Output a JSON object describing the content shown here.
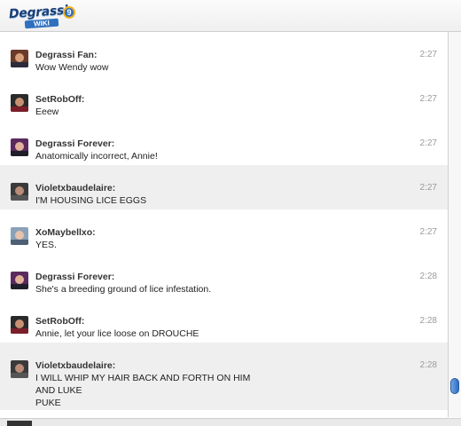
{
  "app": {
    "logo_text": "Degrassi",
    "logo_badge": "9",
    "logo_sub": "WIKI"
  },
  "messages": [
    {
      "user": "Degrassi Fan:",
      "text": "Wow Wendy wow",
      "time": "2:27"
    },
    {
      "user": "SetRobOff:",
      "text": "Eeew",
      "time": "2:27"
    },
    {
      "user": "Degrassi Forever:",
      "text": "Anatomically incorrect, Annie!",
      "time": "2:27"
    },
    {
      "user": "Violetxbaudelaire:",
      "text": "I'M HOUSING LICE EGGS",
      "time": "2:27"
    },
    {
      "user": "XoMaybellxo:",
      "text": "YES.",
      "time": "2:27"
    },
    {
      "user": "Degrassi Forever:",
      "text": "She's a breeding ground of lice infestation.",
      "time": "2:28"
    },
    {
      "user": "SetRobOff:",
      "text": "Annie, let your lice loose on DROUCHE",
      "time": "2:28"
    },
    {
      "user": "Violetxbaudelaire:",
      "text": "I WILL WHIP MY HAIR BACK AND FORTH ON HIM",
      "text2": "AND LUKE",
      "text3": "PUKE",
      "time": "2:28"
    }
  ]
}
